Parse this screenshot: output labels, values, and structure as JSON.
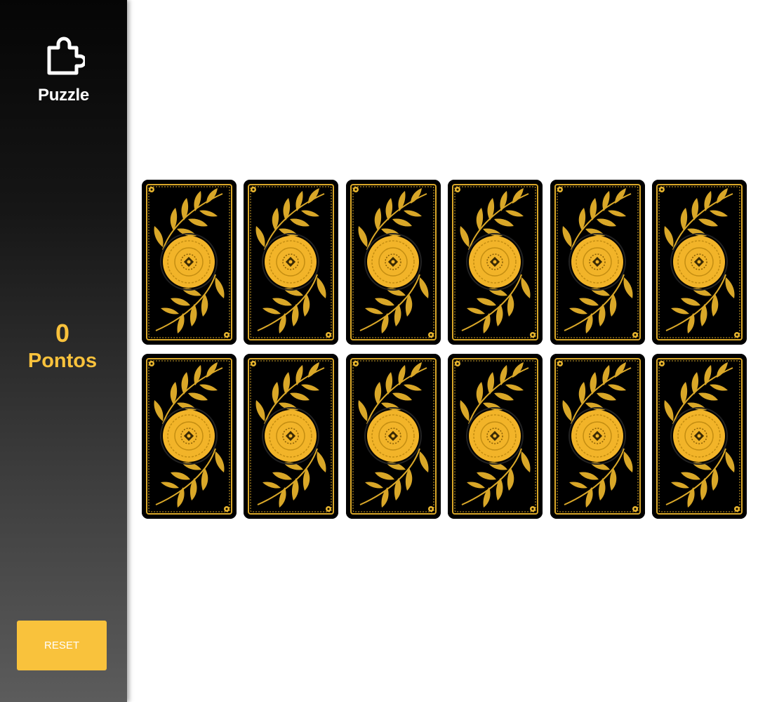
{
  "sidebar": {
    "logo_icon": "puzzle-piece-icon",
    "title": "Puzzle",
    "score": {
      "value": "0",
      "label": "Pontos"
    },
    "reset_label": "RESET"
  },
  "board": {
    "rows": 2,
    "columns": 6,
    "cards": [
      {
        "state": "face-down"
      },
      {
        "state": "face-down"
      },
      {
        "state": "face-down"
      },
      {
        "state": "face-down"
      },
      {
        "state": "face-down"
      },
      {
        "state": "face-down"
      },
      {
        "state": "face-down"
      },
      {
        "state": "face-down"
      },
      {
        "state": "face-down"
      },
      {
        "state": "face-down"
      },
      {
        "state": "face-down"
      },
      {
        "state": "face-down"
      }
    ]
  },
  "colors": {
    "accent": "#f9c23c",
    "sidebar_top": "#050505",
    "sidebar_bottom": "#5c5c5c",
    "card_back": "#000000"
  }
}
